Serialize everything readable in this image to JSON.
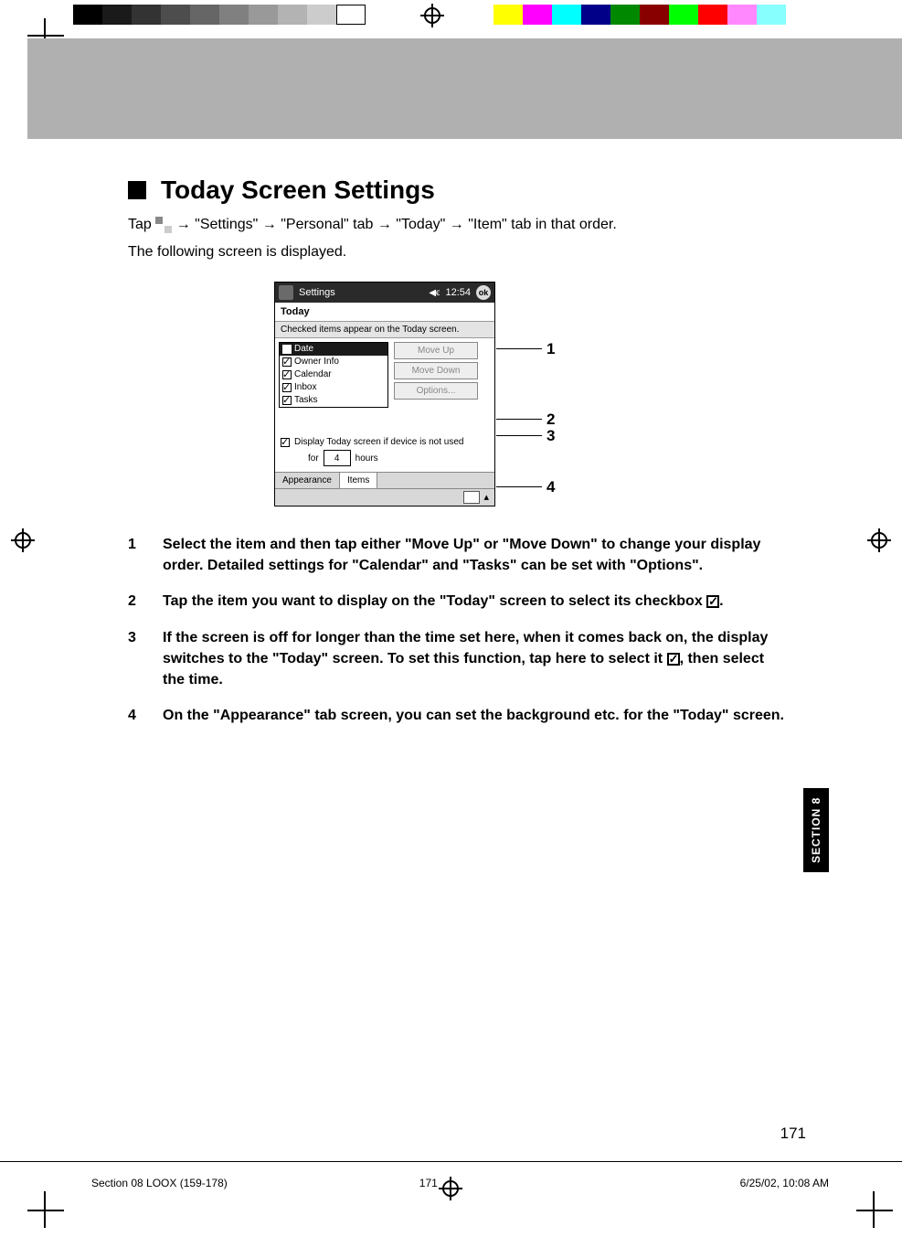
{
  "heading": "Today Screen Settings",
  "intro": {
    "tap": "Tap ",
    "path": " → \"Settings\" → \"Personal\" tab → \"Today\" → \"Item\" tab in that order.",
    "following": "The following screen is displayed."
  },
  "pda": {
    "title": "Settings",
    "time": "12:54",
    "ok": "ok",
    "subtitle": "Today",
    "hint": "Checked items appear on the Today screen.",
    "items": [
      "Date",
      "Owner Info",
      "Calendar",
      "Inbox",
      "Tasks"
    ],
    "buttons": [
      "Move Up",
      "Move Down",
      "Options..."
    ],
    "timeout": {
      "label": "Display Today screen if device is not used",
      "for": "for",
      "hours": "4",
      "hoursLabel": "hours"
    },
    "tabs": [
      "Appearance",
      "Items"
    ]
  },
  "callouts": [
    "1",
    "2",
    "3",
    "4"
  ],
  "list": [
    {
      "n": "1",
      "t": "Select the item and then tap either \"Move Up\" or \"Move Down\" to change your display order. Detailed settings for \"Calendar\" and \"Tasks\" can be set with \"Options\"."
    },
    {
      "n": "2",
      "t": "Tap the item you want to display on the \"Today\" screen to select its checkbox",
      "tail": "."
    },
    {
      "n": "3",
      "t": "If the screen is off for longer than the time set here, when it comes back on, the display switches to the \"Today\" screen. To set this function, tap here to select it",
      "tail": ", then select the time."
    },
    {
      "n": "4",
      "t": "On the \"Appearance\" tab screen, you can set the background etc. for the \"Today\" screen."
    }
  ],
  "sectionTab": "SECTION 8",
  "pageNumber": "171",
  "footer": {
    "file": "Section 08 LOOX (159-178)",
    "page": "171",
    "date": "6/25/02, 10:08 AM"
  }
}
